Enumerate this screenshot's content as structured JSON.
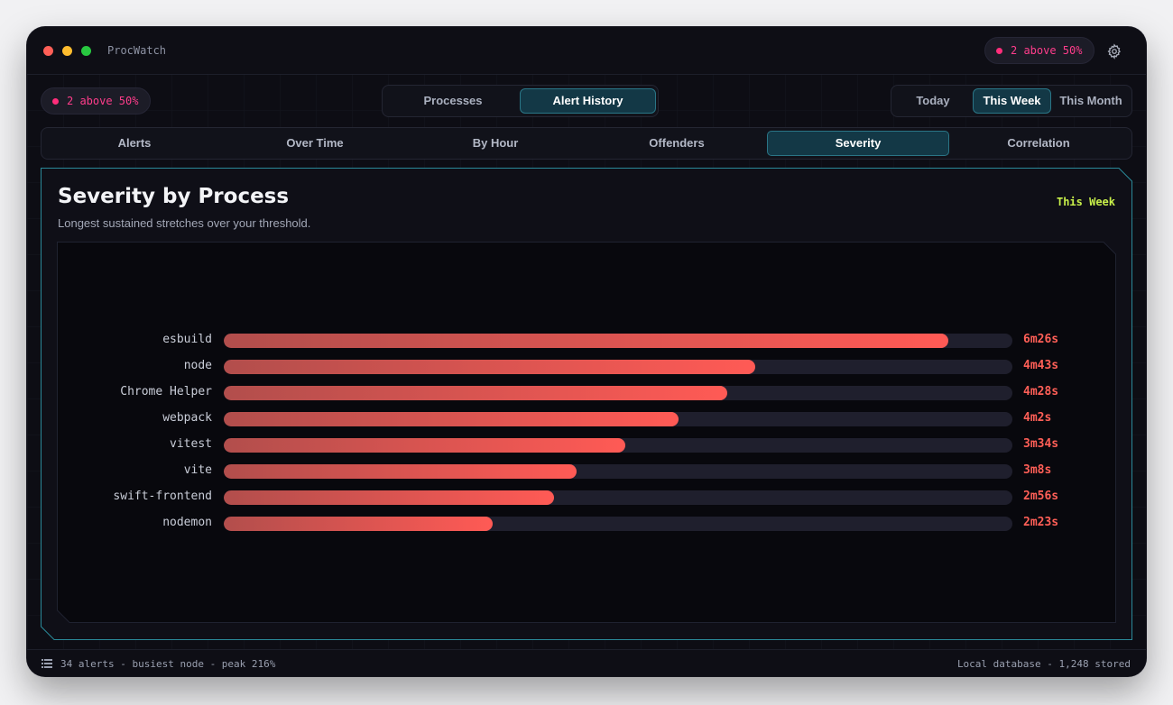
{
  "app": {
    "title": "ProcWatch"
  },
  "alert_pill": {
    "text": "2 above 50%"
  },
  "view_switch": {
    "options": [
      "Processes",
      "Alert History"
    ],
    "active": "Alert History"
  },
  "range_switch": {
    "options": [
      "Today",
      "This Week",
      "This Month"
    ],
    "active": "This Week"
  },
  "tabs": {
    "items": [
      "Alerts",
      "Over Time",
      "By Hour",
      "Offenders",
      "Severity",
      "Correlation"
    ],
    "active": "Severity"
  },
  "panel": {
    "title": "Severity by Process",
    "subtitle": "Longest sustained stretches over your threshold.",
    "range_label": "This Week"
  },
  "chart_data": {
    "type": "bar",
    "orientation": "horizontal",
    "unit": "seconds",
    "categories": [
      "esbuild",
      "node",
      "Chrome Helper",
      "webpack",
      "vitest",
      "vite",
      "swift-frontend",
      "nodemon"
    ],
    "values": [
      386,
      283,
      268,
      242,
      214,
      188,
      176,
      143
    ],
    "value_labels": [
      "6m26s",
      "4m43s",
      "4m28s",
      "4m2s",
      "3m34s",
      "3m8s",
      "2m56s",
      "2m23s"
    ],
    "xlim": [
      0,
      420
    ],
    "colors": {
      "bar_start": "#b24e4c",
      "bar_end": "#ff5a55",
      "track": "#1f1f2d"
    }
  },
  "status": {
    "left": "34 alerts - busiest node - peak 216%",
    "right": "Local database - 1,248 stored"
  },
  "colors": {
    "accent": "#2a7586",
    "alert": "#ff2d7a",
    "range_label": "#c8f04a",
    "value": "#ff5f57"
  }
}
